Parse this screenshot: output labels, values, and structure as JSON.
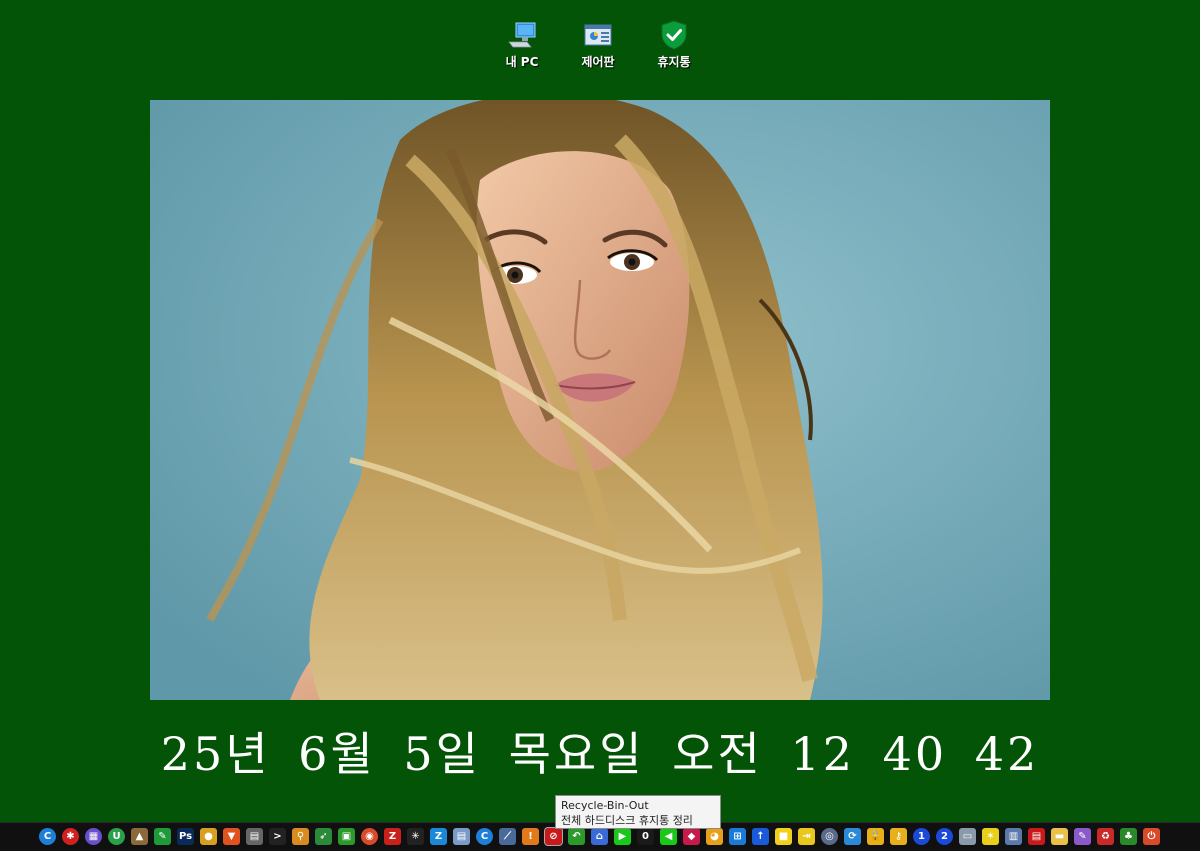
{
  "desktop": {
    "icons": [
      {
        "label": "내 PC",
        "icon": "computer-icon"
      },
      {
        "label": "제어판",
        "icon": "control-panel-icon"
      },
      {
        "label": "휴지통",
        "icon": "recycle-bin-shield-icon"
      }
    ]
  },
  "wallpaper": {
    "subject": "photo-wallpaper"
  },
  "clock": {
    "text": "25년 6월 5일 목요일 오전 12 40 42"
  },
  "tooltip": {
    "title": "Recycle-Bin-Out",
    "description": "전체 하드디스크 휴지통 정리"
  },
  "taskbar": {
    "icons": [
      "ccleaner-icon",
      "red-circle-icon",
      "purple-grid-icon",
      "green-u-icon",
      "landscape-icon",
      "pen-icon",
      "photoshop-icon",
      "bird-icon",
      "brave-icon",
      "calculator-icon",
      "cmd-icon",
      "search-icon",
      "rocket-icon",
      "photo-icon",
      "chrome-icon",
      "filezilla-icon",
      "asterisk-icon",
      "z-app-icon",
      "notepad-icon",
      "ccleaner2-icon",
      "brush-icon",
      "warning-icon",
      "recycle-bin-out-icon",
      "recycle-arrow-icon",
      "home-icon",
      "play-icon",
      "counter-icon",
      "back-arrow-icon",
      "shield-app-icon",
      "orange-app-icon",
      "windows-icon",
      "up-arrow-icon",
      "yellow-note-icon",
      "exit-icon",
      "compass-icon",
      "sync-icon",
      "lock-icon",
      "key-icon",
      "number-1-icon",
      "number-2-icon",
      "monitor-icon",
      "hazard-icon",
      "server-icon",
      "red-book-icon",
      "folder-icon",
      "paint-icon",
      "recycle-icon",
      "tree-icon",
      "power-icon"
    ]
  }
}
